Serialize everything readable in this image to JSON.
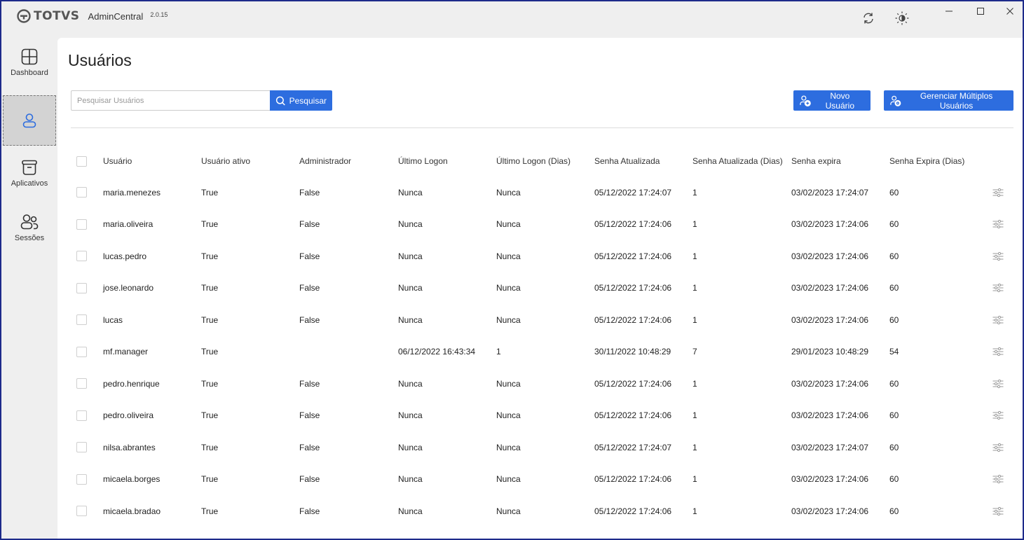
{
  "app": {
    "brand": "TOTVS",
    "name": "AdminCentral",
    "version": "2.0.15"
  },
  "window_controls": {
    "minimize": "—",
    "maximize": "☐",
    "close": "✕"
  },
  "sidebar": {
    "items": [
      {
        "label": "Dashboard",
        "icon": "dashboard-icon"
      },
      {
        "label": "",
        "icon": "user-icon",
        "active": true
      },
      {
        "label": "Aplicativos",
        "icon": "archive-icon"
      },
      {
        "label": "Sessões",
        "icon": "sessions-icon"
      }
    ]
  },
  "page": {
    "title": "Usuários",
    "search_placeholder": "Pesquisar Usuários",
    "search_button": "Pesquisar",
    "new_user_button": "Novo Usuário",
    "manage_multiple_button": "Gerenciar Múltiplos Usuários"
  },
  "colors": {
    "accent": "#2d6ddf",
    "sidebar_bg": "#efefef",
    "active_nav": "#d3d3d3"
  },
  "table": {
    "headers": [
      "Usuário",
      "Usuário ativo",
      "Administrador",
      "Último Logon",
      "Último Logon (Dias)",
      "Senha Atualizada",
      "Senha Atualizada (Dias)",
      "Senha expira",
      "Senha Expira (Dias)"
    ],
    "rows": [
      [
        "maria.menezes",
        "True",
        "False",
        "Nunca",
        "Nunca",
        "05/12/2022 17:24:07",
        "1",
        "03/02/2023 17:24:07",
        "60"
      ],
      [
        "maria.oliveira",
        "True",
        "False",
        "Nunca",
        "Nunca",
        "05/12/2022 17:24:06",
        "1",
        "03/02/2023 17:24:06",
        "60"
      ],
      [
        "lucas.pedro",
        "True",
        "False",
        "Nunca",
        "Nunca",
        "05/12/2022 17:24:06",
        "1",
        "03/02/2023 17:24:06",
        "60"
      ],
      [
        "jose.leonardo",
        "True",
        "False",
        "Nunca",
        "Nunca",
        "05/12/2022 17:24:06",
        "1",
        "03/02/2023 17:24:06",
        "60"
      ],
      [
        "lucas",
        "True",
        "False",
        "Nunca",
        "Nunca",
        "05/12/2022 17:24:06",
        "1",
        "03/02/2023 17:24:06",
        "60"
      ],
      [
        "mf.manager",
        "True",
        "",
        "06/12/2022 16:43:34",
        "1",
        "30/11/2022 10:48:29",
        "7",
        "29/01/2023 10:48:29",
        "54"
      ],
      [
        "pedro.henrique",
        "True",
        "False",
        "Nunca",
        "Nunca",
        "05/12/2022 17:24:06",
        "1",
        "03/02/2023 17:24:06",
        "60"
      ],
      [
        "pedro.oliveira",
        "True",
        "False",
        "Nunca",
        "Nunca",
        "05/12/2022 17:24:06",
        "1",
        "03/02/2023 17:24:06",
        "60"
      ],
      [
        "nilsa.abrantes",
        "True",
        "False",
        "Nunca",
        "Nunca",
        "05/12/2022 17:24:07",
        "1",
        "03/02/2023 17:24:07",
        "60"
      ],
      [
        "micaela.borges",
        "True",
        "False",
        "Nunca",
        "Nunca",
        "05/12/2022 17:24:06",
        "1",
        "03/02/2023 17:24:06",
        "60"
      ],
      [
        "micaela.bradao",
        "True",
        "False",
        "Nunca",
        "Nunca",
        "05/12/2022 17:24:06",
        "1",
        "03/02/2023 17:24:06",
        "60"
      ]
    ]
  }
}
